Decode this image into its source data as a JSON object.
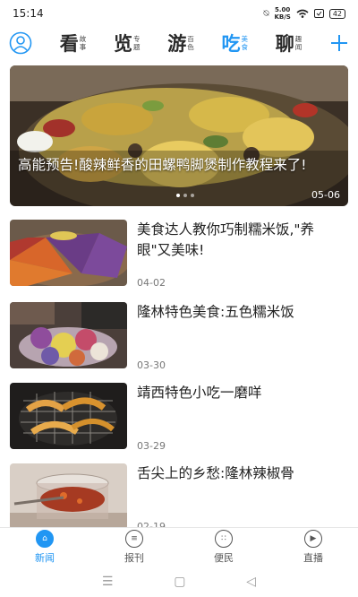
{
  "status": {
    "time": "15:14",
    "speed_value": "5.00",
    "speed_unit": "KB/S",
    "battery": "42"
  },
  "topnav": {
    "items": [
      {
        "big": "看",
        "small1": "故",
        "small2": "事"
      },
      {
        "big": "览",
        "small1": "专",
        "small2": "题"
      },
      {
        "big": "游",
        "small1": "百",
        "small2": "色"
      },
      {
        "big": "吃",
        "small1": "美",
        "small2": "食"
      },
      {
        "big": "聊",
        "small1": "趣",
        "small2": "闻"
      }
    ],
    "active_index": 3,
    "accent": "#2196f3"
  },
  "hero": {
    "caption": "高能预告!酸辣鲜香的田螺鸭脚煲制作教程来了!",
    "date": "05-06"
  },
  "news": [
    {
      "title": "美食达人教你巧制糯米饭,\"养眼\"又美味!",
      "date": "04-02"
    },
    {
      "title": "隆林特色美食:五色糯米饭",
      "date": "03-30"
    },
    {
      "title": "靖西特色小吃一磨咩",
      "date": "03-29"
    },
    {
      "title": "舌尖上的乡愁:隆林辣椒骨",
      "date": "02-19"
    }
  ],
  "tabbar": [
    {
      "label": "新闻",
      "icon": "home-icon"
    },
    {
      "label": "报刊",
      "icon": "newspaper-icon"
    },
    {
      "label": "便民",
      "icon": "grid-icon"
    },
    {
      "label": "直播",
      "icon": "play-icon"
    }
  ]
}
